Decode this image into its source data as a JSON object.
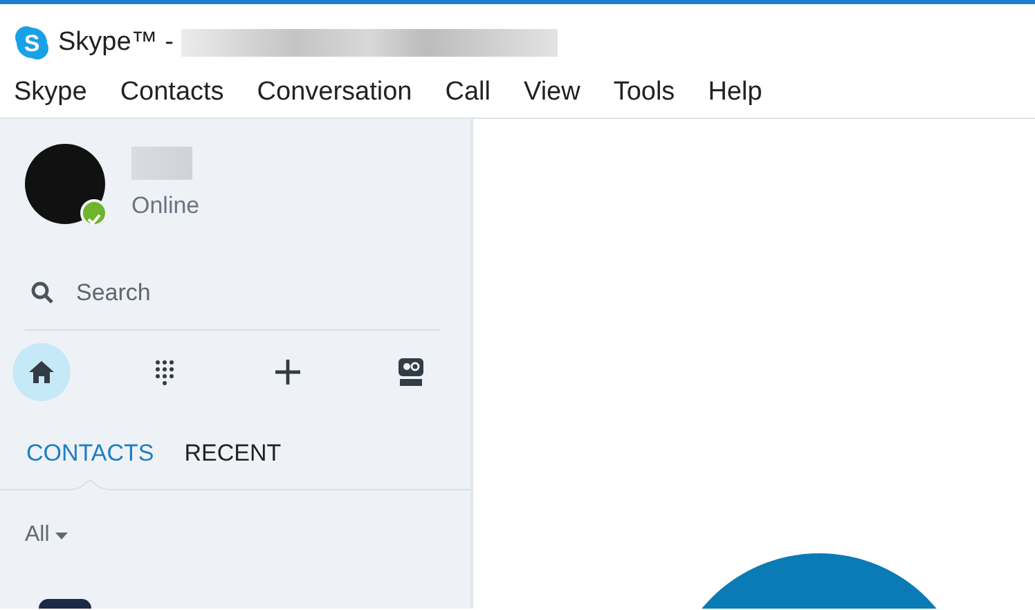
{
  "window": {
    "title": "Skype™ -",
    "logo": "S"
  },
  "menu": [
    "Skype",
    "Contacts",
    "Conversation",
    "Call",
    "View",
    "Tools",
    "Help"
  ],
  "profile": {
    "status": "Online",
    "online": true
  },
  "search": {
    "placeholder": "Search"
  },
  "toolbar": [
    {
      "kind": "home",
      "selected": true
    },
    {
      "kind": "dialpad",
      "selected": false
    },
    {
      "kind": "add",
      "selected": false
    },
    {
      "kind": "bot",
      "selected": false
    }
  ],
  "tabs": [
    {
      "label": "CONTACTS",
      "selected": true
    },
    {
      "label": "RECENT",
      "selected": false
    }
  ],
  "filter": {
    "label": "All"
  }
}
